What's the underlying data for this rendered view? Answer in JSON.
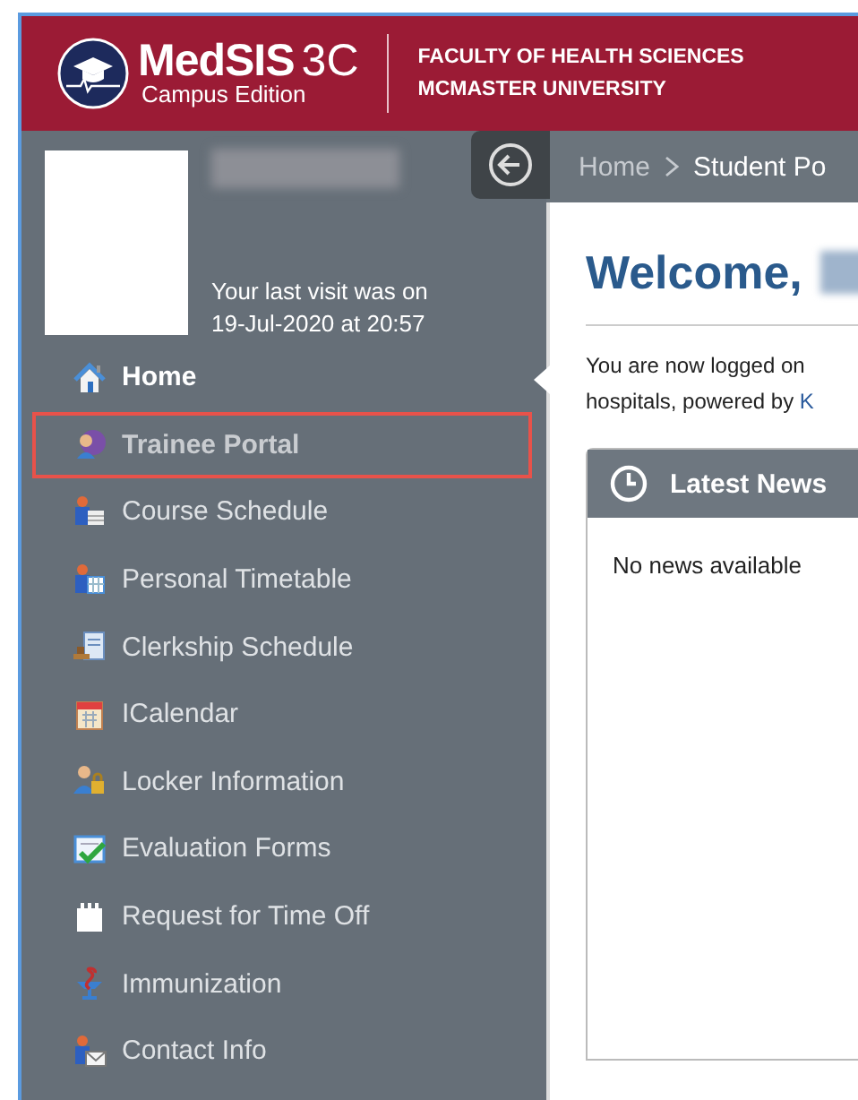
{
  "header": {
    "logo_title": "MedSIS",
    "logo_version": "3C",
    "logo_subtitle": "Campus Edition",
    "org_lines": [
      "FACULTY OF HEALTH SCIENCES",
      "MCMASTER UNIVERSITY"
    ]
  },
  "profile": {
    "last_visit": [
      "Your last visit was on",
      "19-Jul-2020 at 20:57"
    ]
  },
  "sidebar": {
    "items": [
      {
        "label": "Home",
        "selected": true,
        "outlined": false,
        "bold": true
      },
      {
        "label": "Trainee Portal",
        "selected": false,
        "outlined": true,
        "bold": true
      },
      {
        "label": "Course Schedule",
        "selected": false,
        "outlined": false,
        "bold": false
      },
      {
        "label": "Personal Timetable",
        "selected": false,
        "outlined": false,
        "bold": false
      },
      {
        "label": "Clerkship Schedule",
        "selected": false,
        "outlined": false,
        "bold": false
      },
      {
        "label": "ICalendar",
        "selected": false,
        "outlined": false,
        "bold": false
      },
      {
        "label": "Locker Information",
        "selected": false,
        "outlined": false,
        "bold": false
      },
      {
        "label": "Evaluation Forms",
        "selected": false,
        "outlined": false,
        "bold": false
      },
      {
        "label": "Request for Time Off",
        "selected": false,
        "outlined": false,
        "bold": false
      },
      {
        "label": "Immunization",
        "selected": false,
        "outlined": false,
        "bold": false
      },
      {
        "label": "Contact Info",
        "selected": false,
        "outlined": false,
        "bold": false
      }
    ]
  },
  "breadcrumb": [
    {
      "label": "Home",
      "current": false
    },
    {
      "label": "Student Po",
      "current": true
    }
  ],
  "main": {
    "welcome": "Welcome,",
    "intro_lines": [
      "You are now logged on",
      "hospitals, powered by "
    ],
    "intro_link": "K",
    "news": {
      "title": "Latest News",
      "empty": "No news available"
    }
  }
}
